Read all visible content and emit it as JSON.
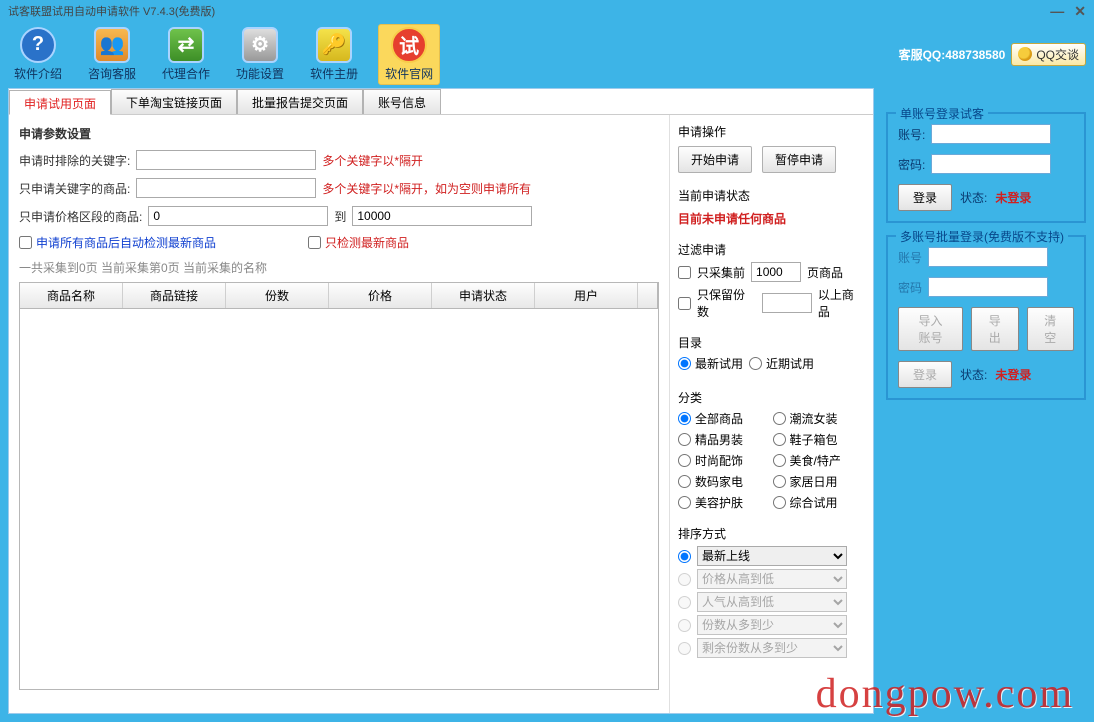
{
  "window": {
    "title": "试客联盟试用自动申请软件 V7.4.3(免费版)"
  },
  "toolbar": [
    {
      "name": "intro",
      "label": "软件介绍",
      "icon": "?"
    },
    {
      "name": "support",
      "label": "咨询客服",
      "icon": "users"
    },
    {
      "name": "agent",
      "label": "代理合作",
      "icon": "share"
    },
    {
      "name": "settings",
      "label": "功能设置",
      "icon": "gears"
    },
    {
      "name": "register",
      "label": "软件主册",
      "icon": "key"
    },
    {
      "name": "website",
      "label": "软件官网",
      "icon": "试",
      "active": true
    }
  ],
  "qq": {
    "label": "客服QQ:488738580",
    "badge": "QQ交谈"
  },
  "tabs": [
    {
      "label": "申请试用页面",
      "active": true
    },
    {
      "label": "下单淘宝链接页面"
    },
    {
      "label": "批量报告提交页面"
    },
    {
      "label": "账号信息"
    }
  ],
  "params": {
    "title": "申请参数设置",
    "excludeKw": {
      "label": "申请时排除的关键字:",
      "value": "",
      "hint": "多个关键字以*隔开"
    },
    "onlyKw": {
      "label": "只申请关键字的商品:",
      "value": "",
      "hint": "多个关键字以*隔开，如为空则申请所有"
    },
    "priceRange": {
      "label": "只申请价格区段的商品:",
      "from": "0",
      "toLabel": "到",
      "to": "10000"
    },
    "chk1": "申请所有商品后自动检测最新商品",
    "chk2": "只检测最新商品",
    "statusLine": "一共采集到0页    当前采集第0页    当前采集的名称"
  },
  "grid": {
    "headers": [
      "商品名称",
      "商品链接",
      "份数",
      "价格",
      "申请状态",
      "用户"
    ]
  },
  "rpane": {
    "opTitle": "申请操作",
    "btnStart": "开始申请",
    "btnPause": "暂停申请",
    "curStatusTitle": "当前申请状态",
    "curStatusText": "目前未申请任何商品",
    "filterTitle": "过滤申请",
    "chkTopN": {
      "pre": "只采集前",
      "value": "1000",
      "post": "页商品"
    },
    "chkKeep": {
      "pre": "只保留份数",
      "value": "",
      "post": "以上商品"
    },
    "dirTitle": "目录",
    "dirOpts": [
      "最新试用",
      "近期试用"
    ],
    "catTitle": "分类",
    "catOpts": [
      "全部商品",
      "潮流女装",
      "精品男装",
      "鞋子箱包",
      "时尚配饰",
      "美食/特产",
      "数码家电",
      "家居日用",
      "美容护肤",
      "综合试用"
    ],
    "sortTitle": "排序方式",
    "sortOpts": [
      "最新上线",
      "价格从高到低",
      "人气从高到低",
      "份数从多到少",
      "剩余份数从多到少"
    ]
  },
  "side1": {
    "title": "单账号登录试客",
    "acct": "账号:",
    "pwd": "密码:",
    "login": "登录",
    "statusPre": "状态:",
    "status": "未登录"
  },
  "side2": {
    "title": "多账号批量登录(免费版不支持)",
    "acct": "账号",
    "pwd": "密码",
    "btnImport": "导入账号",
    "btnExport": "导出",
    "btnClear": "清空",
    "login": "登录",
    "statusPre": "状态:",
    "status": "未登录"
  },
  "watermark": "dongpow.com"
}
